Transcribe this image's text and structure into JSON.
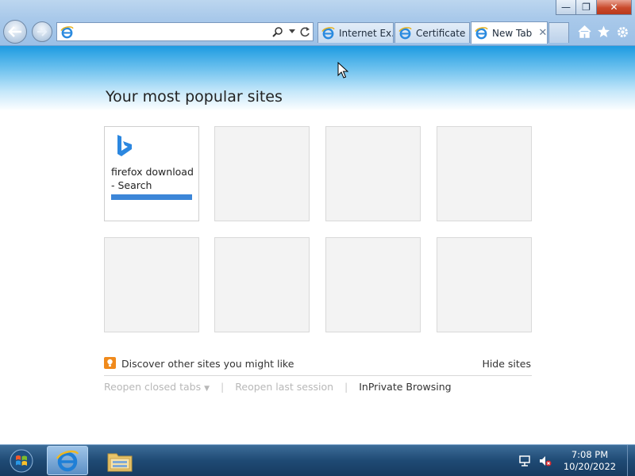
{
  "window": {
    "minimize_label": "—",
    "restore_label": "❐",
    "close_label": "✕"
  },
  "address_bar": {
    "value": "",
    "placeholder": ""
  },
  "tabs": [
    {
      "label": "Internet Ex..."
    },
    {
      "label": "Certificate ..."
    },
    {
      "label": "New Tab",
      "close": "✕"
    }
  ],
  "content": {
    "title": "Your most popular sites",
    "tiles": [
      {
        "label": "firefox download - Search",
        "icon": "bing-icon",
        "load_progress": 1.0
      },
      {
        "label": ""
      },
      {
        "label": ""
      },
      {
        "label": ""
      },
      {
        "label": ""
      },
      {
        "label": ""
      },
      {
        "label": ""
      },
      {
        "label": ""
      }
    ],
    "discover_text": "Discover other sites you might like",
    "hide_sites": "Hide sites",
    "reopen_closed_tabs": "Reopen closed tabs",
    "reopen_last_session": "Reopen last session",
    "inprivate": "InPrivate Browsing"
  },
  "taskbar": {
    "time": "7:08 PM",
    "date": "10/20/2022"
  },
  "colors": {
    "accent": "#1d9be1",
    "discover_icon": "#f08a1c",
    "tile_bar": "#3c86d8"
  }
}
